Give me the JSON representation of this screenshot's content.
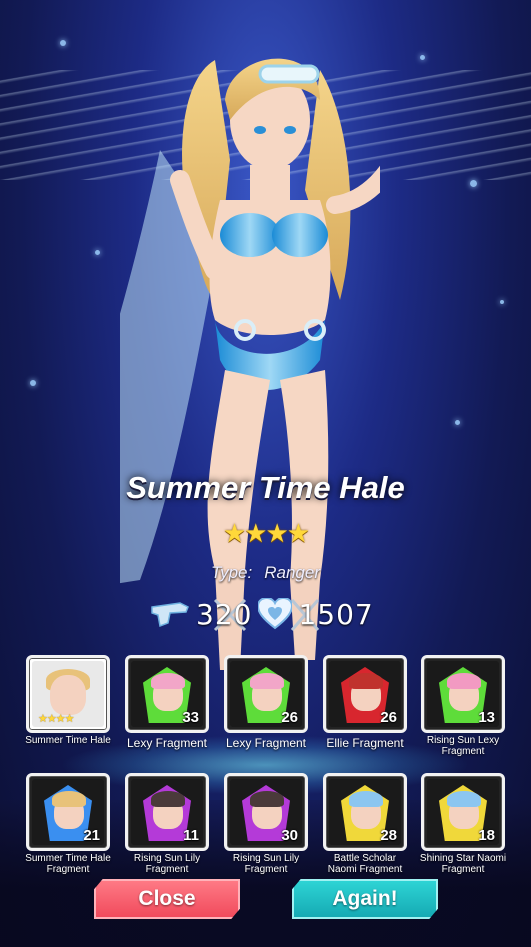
{
  "character": {
    "name": "Summer Time Hale",
    "stars": "★★★★",
    "type_label": "Type:",
    "type_value": "Ranger",
    "attack": "320",
    "health": "1507"
  },
  "rewards": [
    {
      "label": "Summer Time Hale",
      "count": "",
      "gem_color": "",
      "hair_color": "#e8c27a",
      "selected": true,
      "stars": "★★★★"
    },
    {
      "label": "Lexy Fragment",
      "count": "33",
      "gem_color": "#5edc3a",
      "hair_color": "#f2a6c8"
    },
    {
      "label": "Lexy Fragment",
      "count": "26",
      "gem_color": "#5edc3a",
      "hair_color": "#f2a6c8"
    },
    {
      "label": "Ellie Fragment",
      "count": "26",
      "gem_color": "#d8262e",
      "hair_color": "#c0322d"
    },
    {
      "label": "Rising Sun Lexy Fragment",
      "count": "13",
      "gem_color": "#5edc3a",
      "hair_color": "#f29ac2"
    },
    {
      "label": "Summer Time Hale Fragment",
      "count": "21",
      "gem_color": "#3a8ff0",
      "hair_color": "#e8c27a"
    },
    {
      "label": "Rising Sun Lily Fragment",
      "count": "11",
      "gem_color": "#b43ad8",
      "hair_color": "#4a3a3a"
    },
    {
      "label": "Rising Sun Lily Fragment",
      "count": "30",
      "gem_color": "#b43ad8",
      "hair_color": "#4a3a3a"
    },
    {
      "label": "Battle Scholar Naomi Fragment",
      "count": "28",
      "gem_color": "#f0d83a",
      "hair_color": "#8cc6f0"
    },
    {
      "label": "Shining Star Naomi Fragment",
      "count": "18",
      "gem_color": "#f0d83a",
      "hair_color": "#8cc6f0"
    }
  ],
  "buttons": {
    "close": "Close",
    "again": "Again!"
  }
}
